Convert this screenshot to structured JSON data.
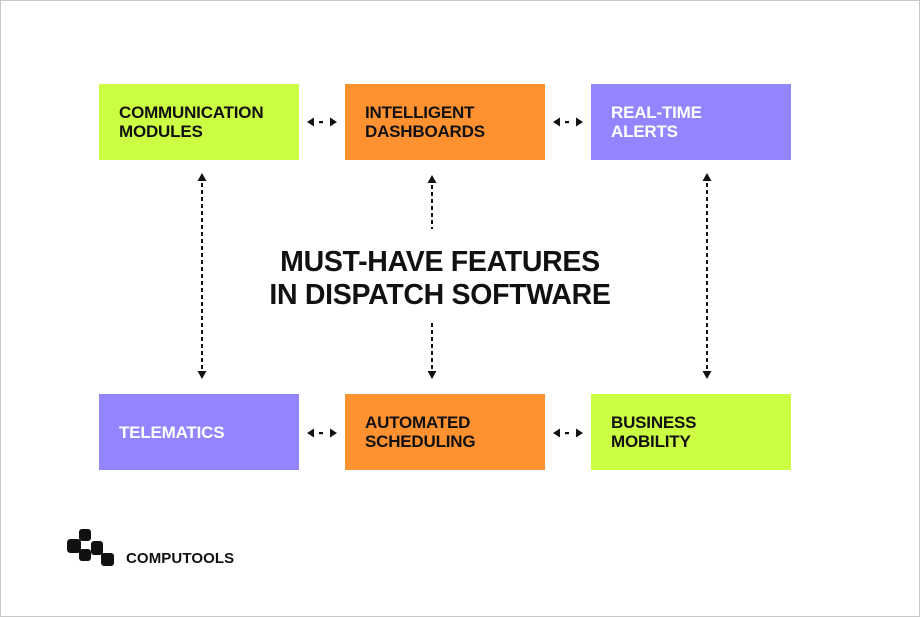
{
  "title": "MUST-HAVE FEATURES\nIN DISPATCH SOFTWARE",
  "colors": {
    "lime": "#ccff44",
    "orange": "#ff9131",
    "purple": "#9384ff",
    "text_dark": "#111111",
    "text_light": "#ffffff"
  },
  "features": {
    "top": [
      {
        "label": "COMMUNICATION\nMODULES",
        "color": "lime"
      },
      {
        "label": "INTELLIGENT\nDASHBOARDS",
        "color": "orange"
      },
      {
        "label": "REAL-TIME\nALERTS",
        "color": "purple"
      }
    ],
    "bottom": [
      {
        "label": "TELEMATICS",
        "color": "purple"
      },
      {
        "label": "AUTOMATED\nSCHEDULING",
        "color": "orange"
      },
      {
        "label": "BUSINESS\nMOBILITY",
        "color": "lime"
      }
    ]
  },
  "connectors": {
    "style": "dotted bidirectional arrow",
    "horizontal_icon": "double-arrow-horizontal-icon",
    "vertical_icon": "double-arrow-vertical-icon"
  },
  "brand": {
    "name": "COMPUTOOLS",
    "icon": "computools-logo-icon"
  }
}
